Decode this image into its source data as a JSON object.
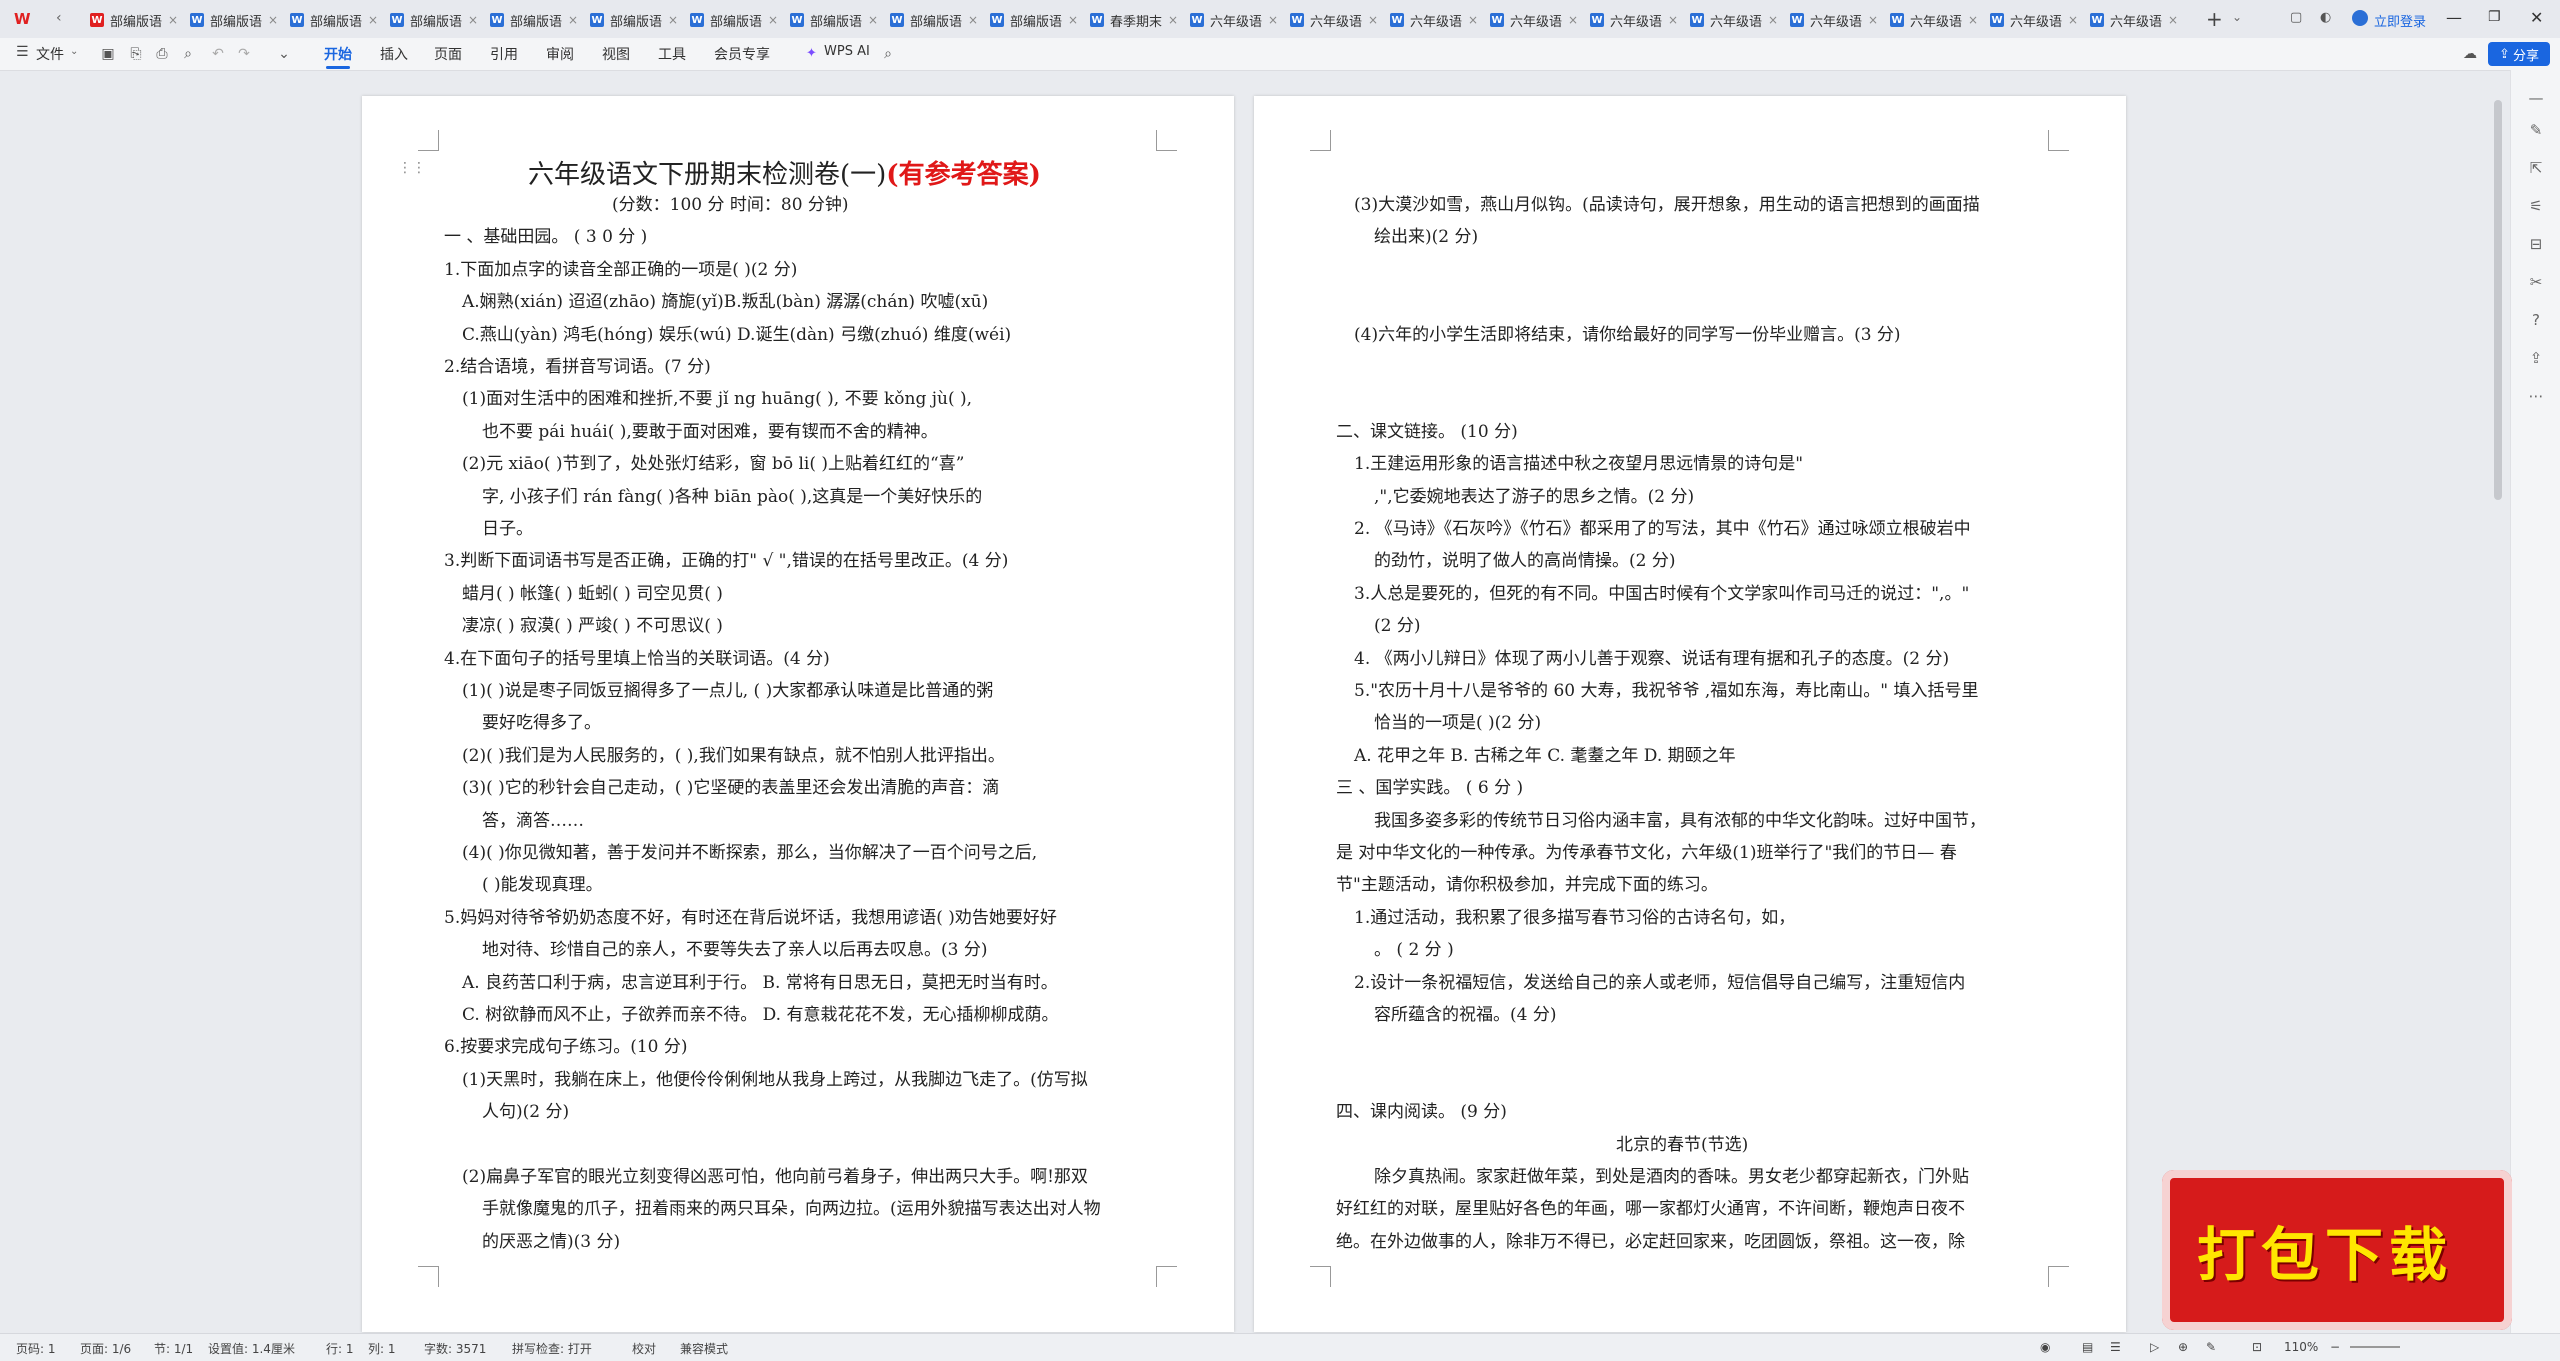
{
  "tabs": [
    {
      "label": "部编版语",
      "type": "wps"
    },
    {
      "label": "部编版语",
      "type": "w"
    },
    {
      "label": "部编版语",
      "type": "w"
    },
    {
      "label": "部编版语",
      "type": "w"
    },
    {
      "label": "部编版语",
      "type": "w"
    },
    {
      "label": "部编版语",
      "type": "w"
    },
    {
      "label": "部编版语",
      "type": "w"
    },
    {
      "label": "部编版语",
      "type": "w"
    },
    {
      "label": "部编版语",
      "type": "w"
    },
    {
      "label": "部编版语",
      "type": "w"
    },
    {
      "label": "春季期末",
      "type": "w"
    },
    {
      "label": "六年级语",
      "type": "w"
    },
    {
      "label": "六年级语",
      "type": "w"
    },
    {
      "label": "六年级语",
      "type": "w"
    },
    {
      "label": "六年级语",
      "type": "w"
    },
    {
      "label": "六年级语",
      "type": "w"
    },
    {
      "label": "六年级语",
      "type": "w"
    },
    {
      "label": "六年级语",
      "type": "w"
    },
    {
      "label": "六年级语",
      "type": "w"
    },
    {
      "label": "六年级语",
      "type": "w"
    },
    {
      "label": "六年级语",
      "type": "w"
    }
  ],
  "login_label": "立即登录",
  "menu": {
    "file": "文件",
    "items": [
      "开始",
      "插入",
      "页面",
      "引用",
      "审阅",
      "视图",
      "工具",
      "会员专享"
    ],
    "active": "开始",
    "wps_ai": "WPS AI",
    "share": "分享"
  },
  "status": {
    "page_code": "页码: 1",
    "page": "页面: 1/6",
    "section": "节: 1/1",
    "setting": "设置值: 1.4厘米",
    "row": "行: 1",
    "col": "列: 1",
    "words": "字数: 3571",
    "spell": "拼写检查: 打开",
    "proof": "校对",
    "compat": "兼容模式",
    "zoom": "110%"
  },
  "doc": {
    "title": "六年级语文下册期末检测卷(一)",
    "title_red": "(有参考答案)",
    "page1_lines": [
      "(分数：100 分        时间：80 分钟)",
      "一 、基础田园。  ( 3 0  分  )",
      "1.下面加点字的读音全部正确的一项是(        )(2 分)",
      "A.娴熟(xián)    迢迢(zhāo)    旖旎(yǐ)B.叛乱(bàn)    潺潺(chán)  吹嘘(xū)",
      "C.燕山(yàn)      鸿毛(hóng)   娱乐(wú)           D.诞生(dàn)      弓缴(zhuó)    维度(wéi)",
      "2.结合语境，看拼音写词语。(7 分)",
      "(1)面对生活中的困难和挫折,不要  jǐ ng huāng(                ),  不要   kǒng jù(                ),",
      "也不要 pái huái(                ),要敢于面对困难，要有锲而不舍的精神。",
      "(2)元 xiāo(            )节到了，处处张灯结彩，窗  bō  li(              )上贴着红红的“喜”",
      "字, 小孩子们  rán fàng(              )各种   biān pào(             ),这真是一个美好快乐的",
      "日子。",
      "3.判断下面词语书写是否正确，正确的打\"   √  \",错误的在括号里改正。(4 分)",
      "蜡月(            )        帐篷(            )        蚯蚓(            )        司空见贯(            )",
      "凄凉(            )        寂漠(            )        严竣(            )        不可思议(            )",
      "4.在下面句子的括号里填上恰当的关联词语。(4 分)",
      "(1)(            )说是枣子同饭豆搁得多了一点儿, (            )大家都承认味道是比普通的粥",
      "要好吃得多了。",
      "(2)(            )我们是为人民服务的，(            ),我们如果有缺点，就不怕别人批评指出。",
      "(3)(            )它的秒针会自己走动，(            )它坚硬的表盖里还会发出清脆的声音：滴",
      "答，滴答……",
      "(4)(            )你见微知著，善于发问并不断探索，那么，当你解决了一百个问号之后,",
      "(            )能发现真理。",
      "5.妈妈对待爷爷奶奶态度不好，有时还在背后说坏话，我想用谚语(        )劝告她要好好",
      "地对待、珍惜自己的亲人，不要等失去了亲人以后再去叹息。(3 分)",
      "A.  良药苦口利于病，忠言逆耳利于行。     B.  常将有日思无日，莫把无时当有时。",
      "C.  树欲静而风不止，子欲养而亲不待。     D.  有意栽花花不发，无心插柳柳成荫。",
      "6.按要求完成句子练习。(10 分)",
      "(1)天黑时，我躺在床上，他便伶伶俐俐地从我身上跨过，从我脚边飞走了。(仿写拟",
      "人句)(2 分)",
      "",
      "(2)扁鼻子军官的眼光立刻变得凶恶可怕，他向前弓着身子，伸出两只大手。啊!那双",
      "手就像魔鬼的爪子，扭着雨来的两只耳朵，向两边拉。(运用外貌描写表达出对人物",
      "的厌恶之情)(3 分)"
    ],
    "page2_lines": [
      "(3)大漠沙如雪，燕山月似钩。(品读诗句，展开想象，用生动的语言把想到的画面描",
      "绘出来)(2 分)",
      "",
      "",
      "(4)六年的小学生活即将结束，请你给最好的同学写一份毕业赠言。(3 分)",
      "",
      "",
      "二、课文链接。  (10 分)",
      "1.王建运用形象的语言描述中秋之夜望月思远情景的诗句是\"",
      ",\",它委婉地表达了游子的思乡之情。(2 分)",
      "2.  《马诗》《石灰吟》《竹石》都采用了的写法，其中《竹石》通过咏颂立根破岩中",
      "的劲竹，说明了做人的高尚情操。(2 分)",
      "3.人总是要死的，但死的有不同。中国古时候有个文学家叫作司马迁的说过：\",。\"",
      "(2 分)",
      "4.  《两小儿辩日》体现了两小儿善于观察、说话有理有据和孔子的态度。(2 分)",
      "5.\"农历十月十八是爷爷的 60 大寿，我祝爷爷    ,福如东海，寿比南山。\" 填入括号里",
      "恰当的一项是(        )(2 分)",
      "A.  花甲之年            B.  古稀之年            C.  耄耋之年                D.  期颐之年",
      "三 、国学实践。  ( 6  分  )",
      "我国多姿多彩的传统节日习俗内涵丰富，具有浓郁的中华文化韵味。过好中国节，",
      "是  对中华文化的一种传承。为传承春节文化，六年级(1)班举行了\"我们的节日—   春",
      "节\"主题活动，请你积极参加，并完成下面的练习。",
      "1.通过活动，我积累了很多描写春节习俗的古诗名句，如，",
      "。 ( 2  分  )",
      "2.设计一条祝福短信，发送给自己的亲人或老师，短信倡导自己编写，注重短信内",
      "容所蕴含的祝福。(4 分)",
      "",
      "",
      "四、课内阅读。  (9 分)",
      "北京的春节(节选)",
      "除夕真热闹。家家赶做年菜，到处是酒肉的香味。男女老少都穿起新衣，门外贴",
      "好红红的对联，屋里贴好各色的年画，哪一家都灯火通宵，不许间断，鞭炮声日夜不",
      "绝。在外边做事的人，除非万不得已，必定赶回家来，吃团圆饭，祭祖。这一夜，除"
    ]
  },
  "promo": "打包下载"
}
